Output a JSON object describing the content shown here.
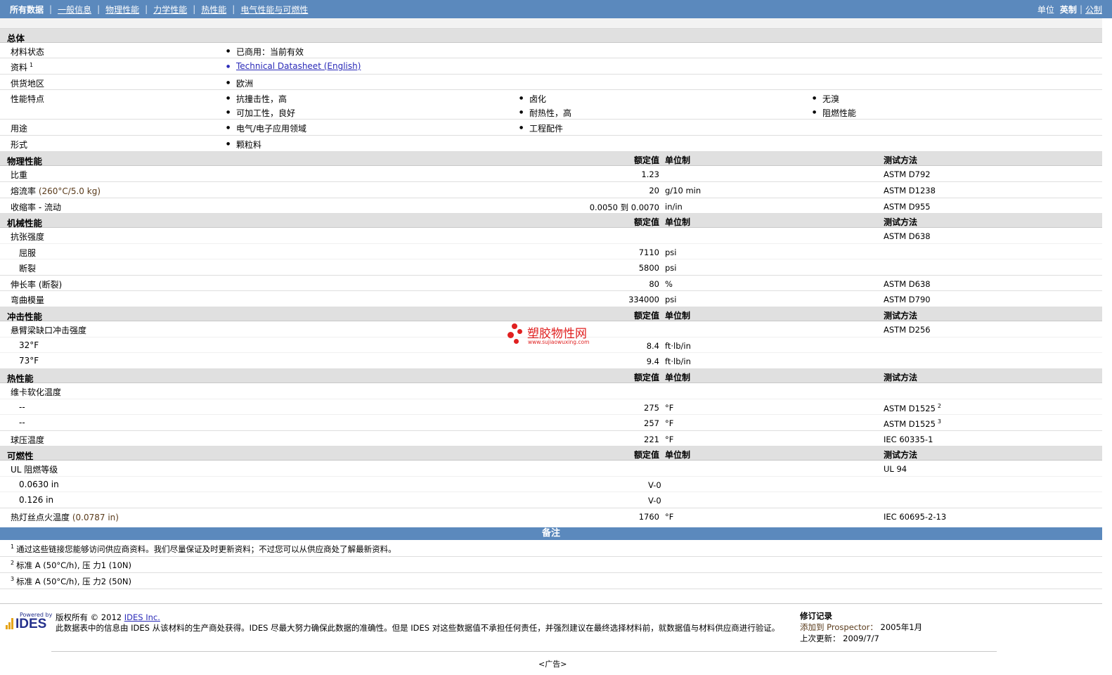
{
  "nav": {
    "items": [
      "所有数据",
      "一般信息",
      "物理性能",
      "力学性能",
      "热性能",
      "电气性能与可燃性"
    ],
    "units_label": "单位",
    "unit_imperial": "英制",
    "unit_metric": "公制"
  },
  "general": {
    "title": "总体",
    "status_label": "材料状态",
    "status_value": "已商用：当前有效",
    "resource_label": "资料",
    "resource_sup": "1",
    "resource_link": "Technical Datasheet (English)",
    "region_label": "供货地区",
    "region_value": "欧洲",
    "features_label": "性能特点",
    "features": [
      "抗撞击性，高",
      "卤化",
      "无溴",
      "可加工性，良好",
      "耐热性，高",
      "阻燃性能"
    ],
    "uses_label": "用途",
    "uses": [
      "电气/电子应用领域",
      "工程配件"
    ],
    "form_label": "形式",
    "form_value": "颗粒料"
  },
  "headers": {
    "value": "额定值",
    "unit": "单位制",
    "method": "测试方法"
  },
  "physical": {
    "title": "物理性能",
    "rows": [
      {
        "label": "比重",
        "cond": "",
        "value": "1.23",
        "unit": "",
        "method": "ASTM D792"
      },
      {
        "label": "熔流率",
        "cond": "(260°C/5.0 kg)",
        "value": "20",
        "unit": "g/10 min",
        "method": "ASTM D1238"
      },
      {
        "label": "收缩率",
        "cond": "- 流动",
        "value": "0.0050 到  0.0070",
        "unit": "in/in",
        "method": "ASTM D955"
      }
    ]
  },
  "mechanical": {
    "title": "机械性能",
    "tensile_label": "抗张强度",
    "tensile_method": "ASTM D638",
    "yield_label": "屈服",
    "yield_value": "7110",
    "yield_unit": "psi",
    "break_label": "断裂",
    "break_value": "5800",
    "break_unit": "psi",
    "elong_label": "伸长率",
    "elong_cond": "(断裂)",
    "elong_value": "80",
    "elong_unit": "%",
    "elong_method": "ASTM D638",
    "flex_label": "弯曲模量",
    "flex_value": "334000",
    "flex_unit": "psi",
    "flex_method": "ASTM D790"
  },
  "impact": {
    "title": "冲击性能",
    "izod_label": "悬臂梁缺口冲击强度",
    "izod_method": "ASTM D256",
    "t1_label": "32°F",
    "t1_value": "8.4",
    "t1_unit": "ft·lb/in",
    "t2_label": "73°F",
    "t2_value": "9.4",
    "t2_unit": "ft·lb/in"
  },
  "thermal": {
    "title": "热性能",
    "vicat_label": "维卡软化温度",
    "v1_label": "--",
    "v1_value": "275",
    "v1_unit": "°F",
    "v1_method": "ASTM D1525",
    "v1_sup": "2",
    "v2_label": "--",
    "v2_value": "257",
    "v2_unit": "°F",
    "v2_method": "ASTM D1525",
    "v2_sup": "3",
    "ball_label": "球压温度",
    "ball_value": "221",
    "ball_unit": "°F",
    "ball_method": "IEC 60335-1"
  },
  "flammability": {
    "title": "可燃性",
    "ul_label": "UL 阻燃等级",
    "ul_method": "UL 94",
    "f1_label": "0.0630 in",
    "f1_value": "V-0",
    "f2_label": "0.126 in",
    "f2_value": "V-0",
    "gwit_label": "热灯丝点火温度",
    "gwit_cond": "(0.0787 in)",
    "gwit_value": "1760",
    "gwit_unit": "°F",
    "gwit_method": "IEC 60695-2-13"
  },
  "notes": {
    "title": "备注",
    "items": [
      {
        "sup": "1",
        "text": "通过这些链接您能够访问供应商资料。我们尽量保证及时更新资料；不过您可以从供应商处了解最新资料。"
      },
      {
        "sup": "2",
        "text": "标准  A (50°C/h), 压  力1 (10N)"
      },
      {
        "sup": "3",
        "text": "标准  A (50°C/h), 压  力2 (50N)"
      }
    ]
  },
  "footer": {
    "powered_by": "Powered by",
    "logo_text": "IDES",
    "copyright": "版权所有  © 2012",
    "copyright_link": "IDES Inc.",
    "disclaimer": "此数据表中的信息由  IDES 从该材料的生产商处获得。IDES 尽最大努力确保此数据的准确性。但是  IDES 对这些数据值不承担任何责任，并强烈建议在最终选择材料前，就数据值与材料供应商进行验证。",
    "revision_title": "修订记录",
    "added_label": "添加到  Prospector：",
    "added_value": "2005年1月",
    "updated_label": "上次更新：",
    "updated_value": "2009/7/7",
    "ad": "<广告>"
  },
  "watermark": {
    "cn": "塑胶物性网",
    "url": "www.sujiaowuxing.com"
  }
}
